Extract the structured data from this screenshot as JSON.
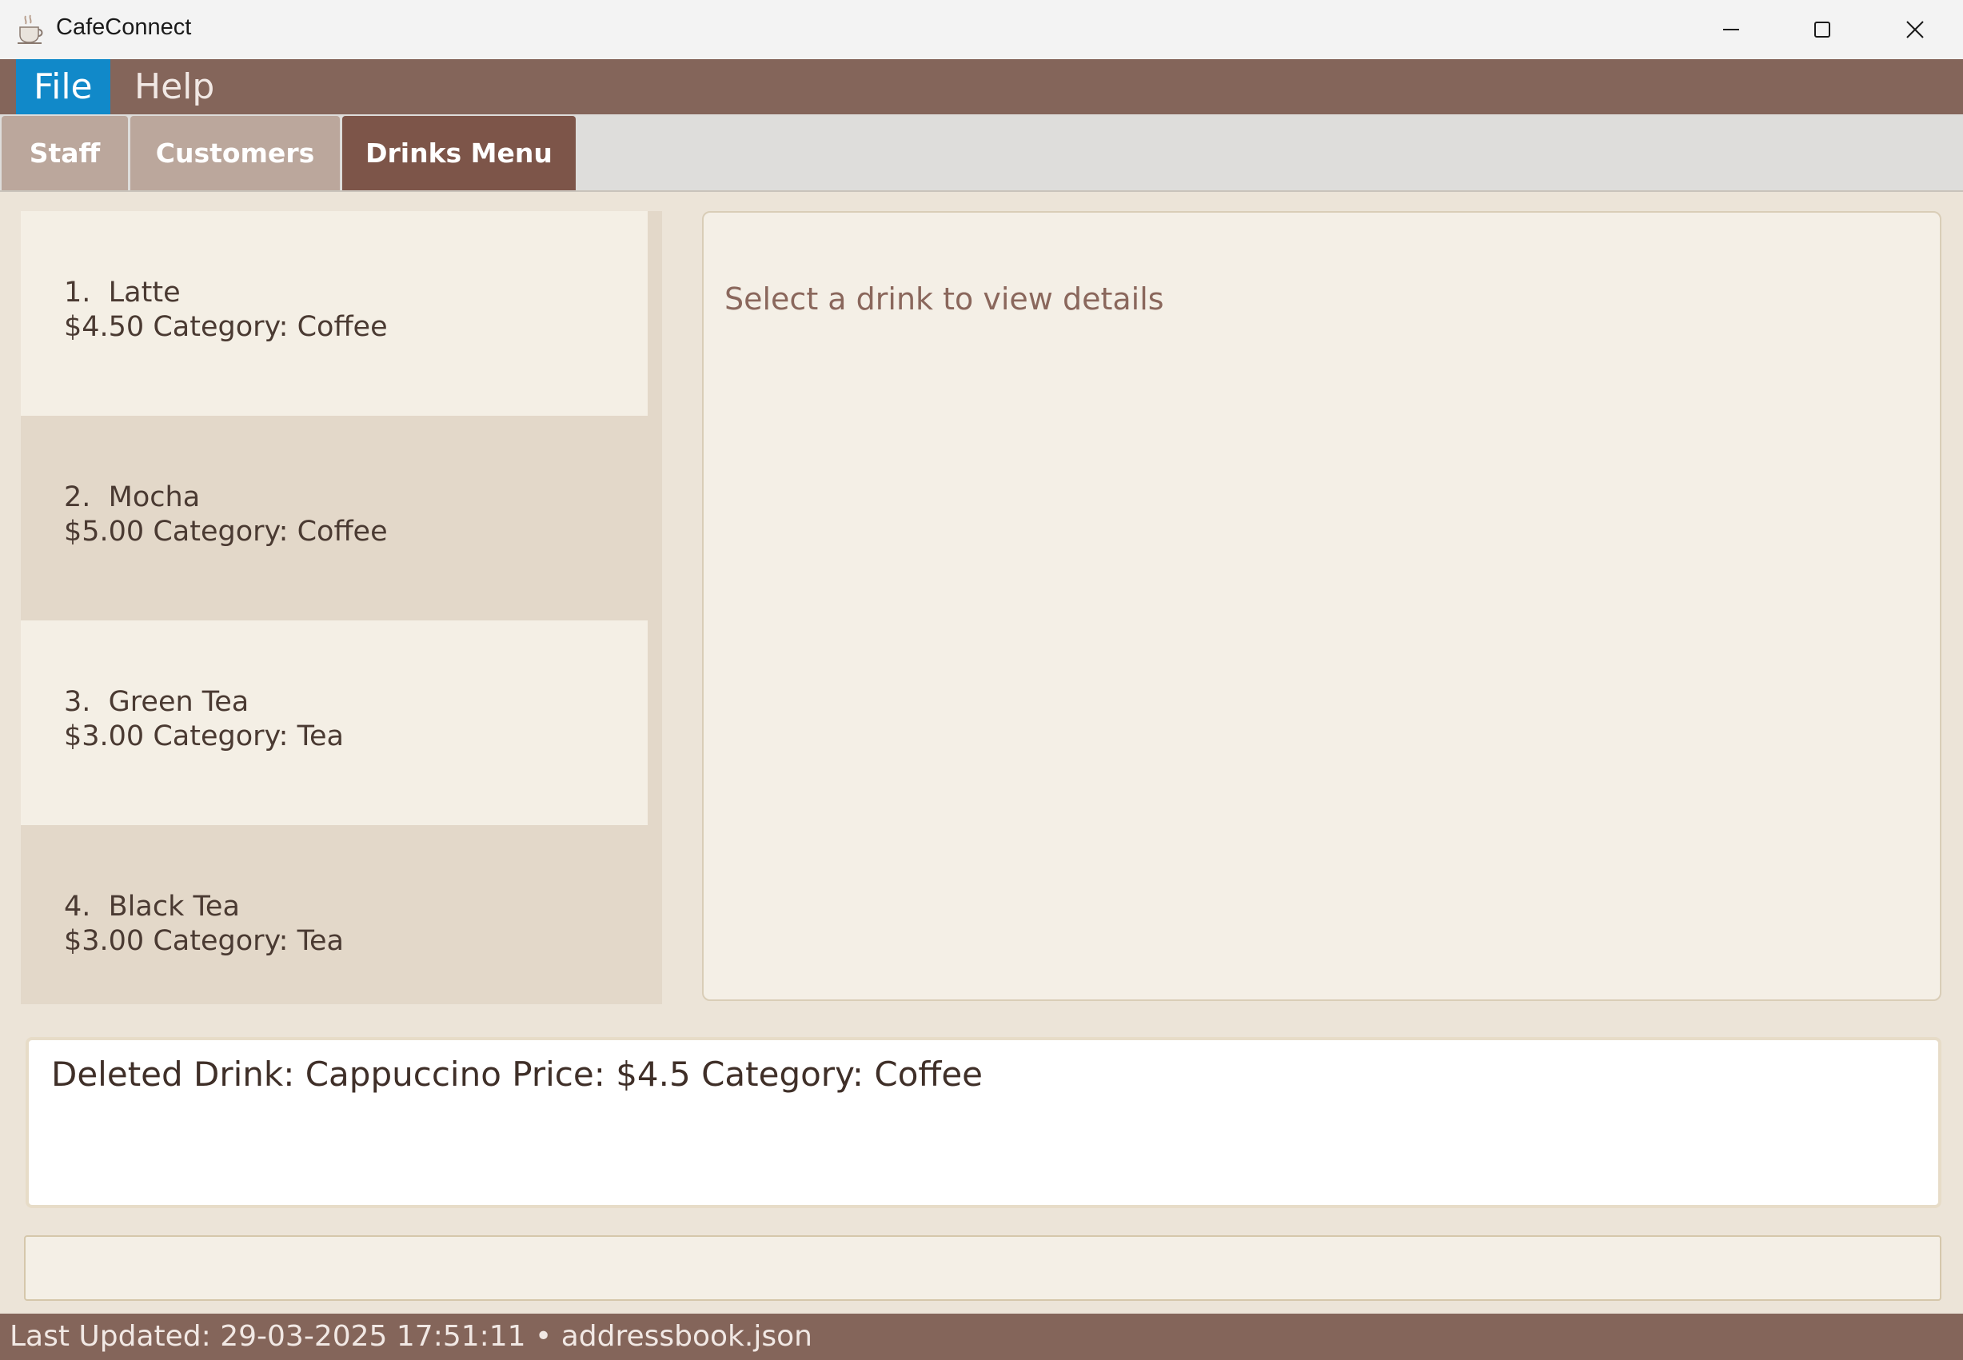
{
  "window": {
    "title": "CafeConnect",
    "icon": "coffee-cup-icon",
    "controls": [
      "minimize-icon",
      "maximize-icon",
      "close-icon"
    ]
  },
  "menu": {
    "items": [
      {
        "label": "File",
        "active": true
      },
      {
        "label": "Help",
        "active": false
      }
    ]
  },
  "tabs": [
    {
      "label": "Staff",
      "selected": false
    },
    {
      "label": "Customers",
      "selected": false
    },
    {
      "label": "Drinks Menu",
      "selected": true
    }
  ],
  "drinks": [
    {
      "index": "1.",
      "name": "Latte",
      "price": "$4.50",
      "category": "Category: Coffee"
    },
    {
      "index": "2.",
      "name": "Mocha",
      "price": "$5.00",
      "category": "Category: Coffee"
    },
    {
      "index": "3.",
      "name": "Green Tea",
      "price": "$3.00",
      "category": "Category: Tea"
    },
    {
      "index": "4.",
      "name": "Black Tea",
      "price": "$3.00",
      "category": "Category: Tea"
    }
  ],
  "detail": {
    "placeholder": "Select a drink to view details"
  },
  "result": {
    "message": "Deleted Drink: Cappuccino Price: $4.5 Category: Coffee"
  },
  "command": {
    "value": ""
  },
  "status": {
    "text": "Last Updated: 29-03-2025 17:51:11 • addressbook.json"
  },
  "colors": {
    "accent_brown": "#84655a",
    "selected_tab": "#7d5549",
    "menu_highlight": "#1189c9",
    "background": "#ece4d8"
  }
}
